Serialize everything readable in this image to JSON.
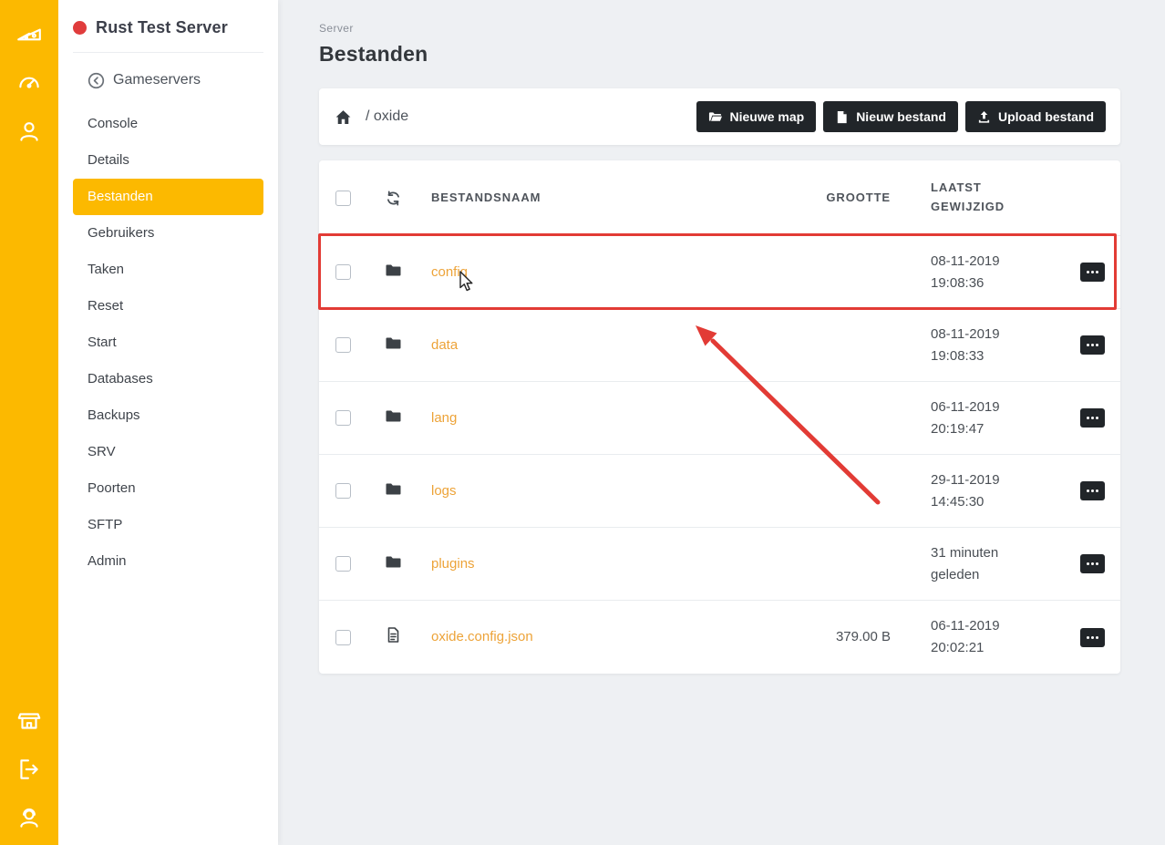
{
  "colors": {
    "accent_yellow": "#fcb900",
    "dark_button": "#212529",
    "file_link_orange": "#eda338",
    "annotation_red": "#e23b35",
    "server_status_dot_red": "#e03c3c"
  },
  "iconbar": {
    "icons": [
      "logo-icon",
      "dashboard-gauge-icon",
      "user-icon",
      "shop-icon",
      "logout-icon",
      "support-icon"
    ]
  },
  "sidebar": {
    "server_name": "Rust Test Server",
    "back_label": "Gameservers",
    "active_item": "Bestanden",
    "items": [
      "Console",
      "Details",
      "Bestanden",
      "Gebruikers",
      "Taken",
      "Reset",
      "Start",
      "Databases",
      "Backups",
      "SRV",
      "Poorten",
      "SFTP",
      "Admin"
    ]
  },
  "page": {
    "eyebrow": "Server",
    "title": "Bestanden"
  },
  "breadcrumb": {
    "path": "/ oxide"
  },
  "toolbar": {
    "new_folder_label": "Nieuwe map",
    "new_file_label": "Nieuw bestand",
    "upload_label": "Upload bestand"
  },
  "table": {
    "headers": {
      "name": "Bestandsnaam",
      "size": "Grootte",
      "modified": "Laatst gewijzigd"
    },
    "rows": [
      {
        "name": "config",
        "kind": "folder",
        "size": "",
        "modified": "08-11-2019 19:08:36",
        "annotated": true
      },
      {
        "name": "data",
        "kind": "folder",
        "size": "",
        "modified": "08-11-2019 19:08:33",
        "annotated": false
      },
      {
        "name": "lang",
        "kind": "folder",
        "size": "",
        "modified": "06-11-2019 20:19:47",
        "annotated": false
      },
      {
        "name": "logs",
        "kind": "folder",
        "size": "",
        "modified": "29-11-2019 14:45:30",
        "annotated": false
      },
      {
        "name": "plugins",
        "kind": "folder",
        "size": "",
        "modified": "31 minuten geleden",
        "annotated": false
      },
      {
        "name": "oxide.config.json",
        "kind": "file",
        "size": "379.00 B",
        "modified": "06-11-2019 20:02:21",
        "annotated": false
      }
    ]
  }
}
